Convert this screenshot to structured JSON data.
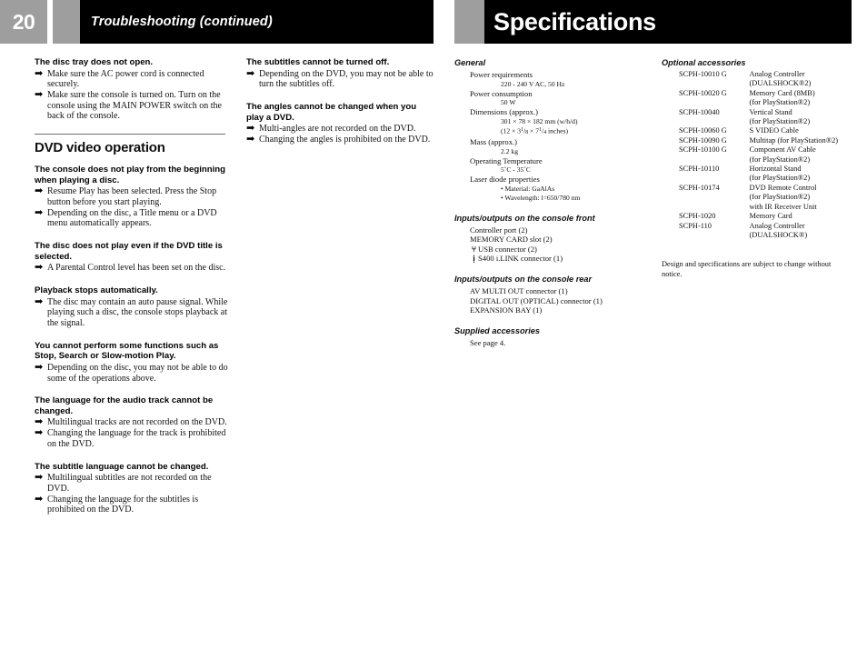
{
  "header": {
    "page_number": "20",
    "left_title": "Troubleshooting (continued)",
    "right_title": "Specifications",
    "gray_color": "#9e9e9e",
    "bar_color": "#000000"
  },
  "troubleshooting": {
    "column_a": {
      "blocks": [
        {
          "heading": "The disc tray does not open.",
          "items": [
            "Make sure the AC power cord is connected securely.",
            "Make sure the console is turned on. Turn on the console using the MAIN POWER switch on the back of the console."
          ]
        }
      ],
      "section_title": "DVD video operation",
      "dvd_blocks": [
        {
          "heading": "The console does not play from the beginning when playing a disc.",
          "items": [
            "Resume Play has been selected. Press the Stop button before you start playing.",
            "Depending on the disc, a Title menu or a DVD menu automatically appears."
          ]
        },
        {
          "heading": "The disc does not play even if the DVD title is selected.",
          "items": [
            "A Parental Control level has been set on the disc."
          ]
        },
        {
          "heading": "Playback stops automatically.",
          "items": [
            "The disc may contain an auto pause signal. While playing such a disc, the console stops playback at the signal."
          ]
        },
        {
          "heading": "You cannot perform some functions such as Stop, Search or Slow-motion Play.",
          "items": [
            "Depending on the disc, you may not be able to do some of the operations above."
          ]
        },
        {
          "heading": "The language for the audio track cannot be changed.",
          "items": [
            "Multilingual tracks are not recorded on the DVD.",
            "Changing the language for the track is prohibited on the DVD."
          ]
        },
        {
          "heading": "The subtitle language cannot be changed.",
          "items": [
            "Multilingual subtitles are not recorded on the DVD.",
            "Changing the language for the subtitles is prohibited on the DVD."
          ]
        }
      ]
    },
    "column_b": {
      "blocks": [
        {
          "heading": "The subtitles cannot be turned off.",
          "items": [
            "Depending on the DVD, you may not be able to turn the subtitles off."
          ]
        },
        {
          "heading": "The angles cannot be changed when you play a DVD.",
          "items": [
            "Multi-angles are not recorded on the DVD.",
            "Changing the angles is prohibited on the DVD."
          ]
        }
      ]
    },
    "arrow_glyph": "➡"
  },
  "specifications": {
    "general": {
      "title": "General",
      "rows": [
        {
          "label": "Power requirements",
          "values": [
            "220 - 240 V AC, 50 Hz"
          ]
        },
        {
          "label": "Power consumption",
          "values": [
            "50 W"
          ]
        },
        {
          "label": "Dimensions (approx.)",
          "values": [
            "301 × 78 × 182 mm (w/h/d)",
            "(12 × 3 1/8 × 7 1/4 inches)"
          ]
        },
        {
          "label": "Mass (approx.)",
          "values": [
            "2.2 kg"
          ]
        },
        {
          "label": "Operating Temperature",
          "values": [
            "5˚C - 35˚C"
          ]
        },
        {
          "label": "Laser diode properties",
          "values": []
        }
      ],
      "bullets": [
        "• Material: GaAlAs",
        "• Wavelength: l=650/780 nm"
      ],
      "dimension_inches_prefix": "(12 × 3",
      "dim_frac1_num": "1",
      "dim_frac1_den": "8",
      "dim_mid": "× 7",
      "dim_frac2_num": "1",
      "dim_frac2_den": "4",
      "dim_suffix": "inches)"
    },
    "front_io": {
      "title": "Inputs/outputs on the console front",
      "rows": [
        {
          "icon": "",
          "text": "Controller port (2)"
        },
        {
          "icon": "",
          "text": "MEMORY CARD slot (2)"
        },
        {
          "icon": "usb-icon",
          "icon_glyph": "⑂",
          "text": "USB connector (2)"
        },
        {
          "icon": "ilink-icon",
          "icon_glyph": "ị",
          "text": "S400 i.LINK connector (1)"
        }
      ]
    },
    "rear_io": {
      "title": "Inputs/outputs on the console rear",
      "rows": [
        "AV MULTI OUT connector (1)",
        "DIGITAL OUT (OPTICAL) connector (1)",
        "EXPANSION BAY (1)"
      ]
    },
    "supplied": {
      "title": "Supplied accessories",
      "rows": [
        "See page 4."
      ]
    },
    "optional": {
      "title": "Optional accessories",
      "items": [
        {
          "code": "SCPH-10010 G",
          "desc": "Analog Controller",
          "sub": "(DUALSHOCK®2)"
        },
        {
          "code": "SCPH-10020 G",
          "desc": "Memory Card (8MB)",
          "sub": "(for PlayStation®2)"
        },
        {
          "code": "SCPH-10040",
          "desc": "Vertical Stand",
          "sub": "(for PlayStation®2)"
        },
        {
          "code": "SCPH-10060 G",
          "desc": "S VIDEO Cable",
          "sub": ""
        },
        {
          "code": "SCPH-10090 G",
          "desc": "Multitap (for PlayStation®2)",
          "sub": ""
        },
        {
          "code": "SCPH-10100 G",
          "desc": "Component AV Cable",
          "sub": "(for PlayStation®2)"
        },
        {
          "code": "SCPH-10110",
          "desc": "Horizontal Stand",
          "sub": "(for PlayStation®2)"
        },
        {
          "code": "SCPH-10174",
          "desc": "DVD Remote Control",
          "sub": "(for PlayStation®2)\nwith IR Receiver Unit"
        },
        {
          "code": "SCPH-1020",
          "desc": "Memory Card",
          "sub": ""
        },
        {
          "code": "SCPH-110",
          "desc": "Analog Controller",
          "sub": "(DUALSHOCK®)"
        }
      ]
    },
    "disclaimer": "Design and specifications are subject to change without notice."
  }
}
